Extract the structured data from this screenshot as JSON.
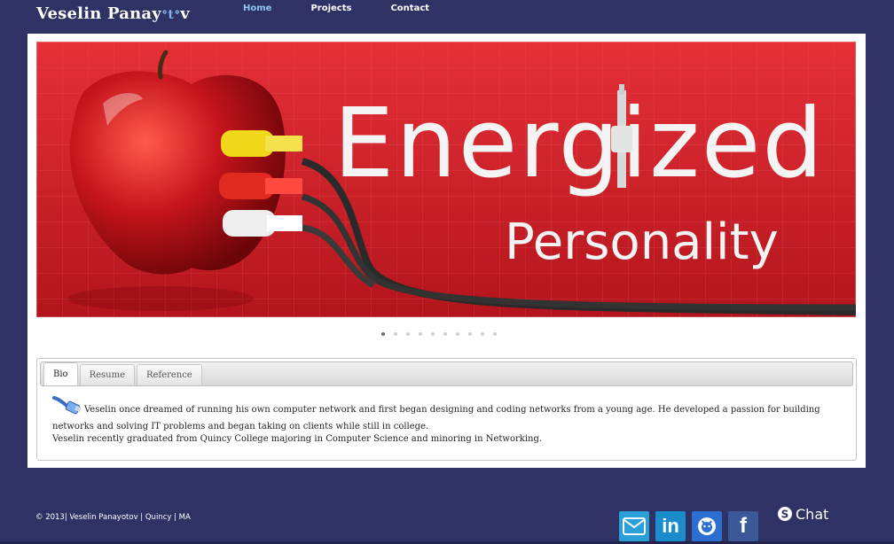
{
  "brand": {
    "name": "Veselin Panay",
    "tail": "ᐤtᐤ",
    "tail_end": "v"
  },
  "nav": [
    {
      "label": "Home",
      "active": true
    },
    {
      "label": "Projects",
      "active": false
    },
    {
      "label": "Contact",
      "active": false
    }
  ],
  "banner": {
    "headline": "Energized",
    "subline": "Personality",
    "slides": 10,
    "active_slide": 1
  },
  "tabs": [
    {
      "label": "Bio",
      "active": true
    },
    {
      "label": "Resume",
      "active": false
    },
    {
      "label": "Reference",
      "active": false
    }
  ],
  "bio": {
    "paragraph1": "Veselin once dreamed of running his own computer network and first began designing and coding networks from a young age. He developed a passion for building networks and solving IT problems and began taking on clients while still in college.",
    "paragraph2": "Veselin recently graduated from Quincy College majoring in Computer Science and minoring in Networking."
  },
  "footer": {
    "copyright": "© 2013| Veselin Panayotov | Quincy | MA",
    "chat_label": "Chat"
  },
  "social": [
    {
      "name": "mail-icon",
      "color": "#2a9fd8"
    },
    {
      "name": "linkedin-icon",
      "color": "#1a8ccc"
    },
    {
      "name": "github-icon",
      "color": "#2d6fd0"
    },
    {
      "name": "facebook-icon",
      "color": "#3b5998"
    }
  ],
  "colors": {
    "background": "#2e3264",
    "banner_red": "#d01e24",
    "nav_active": "#8ec8f0"
  }
}
